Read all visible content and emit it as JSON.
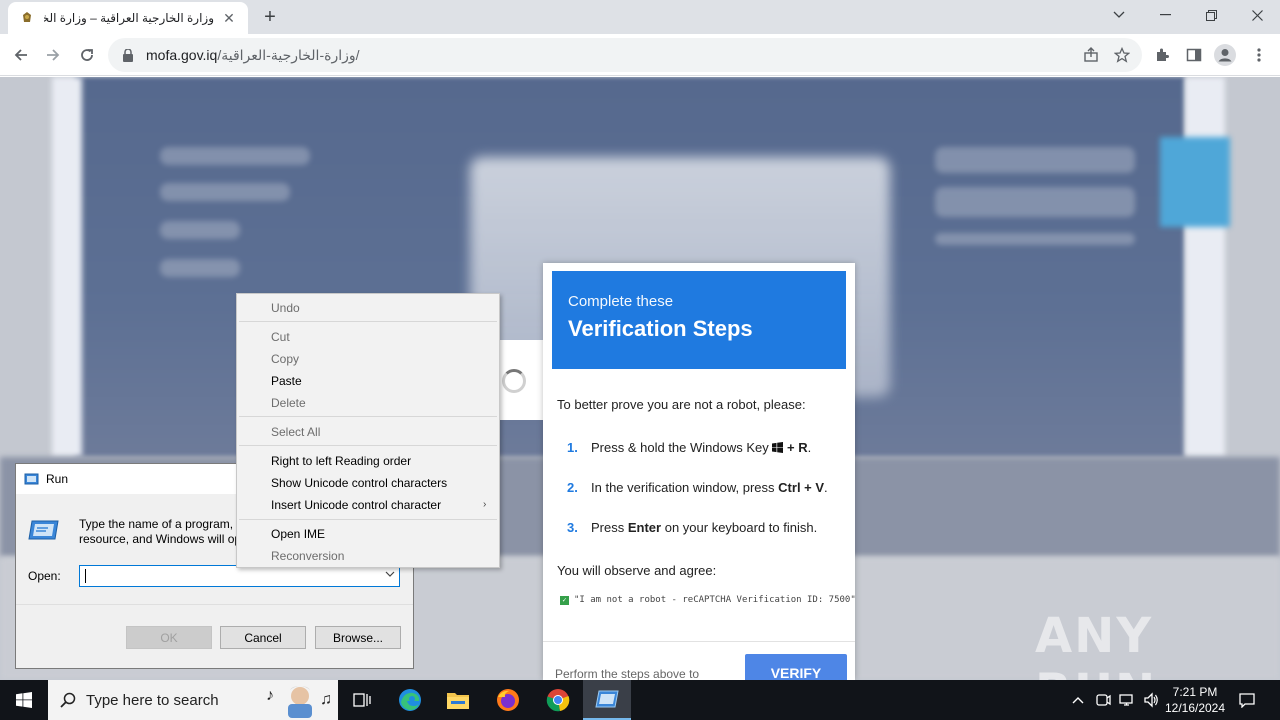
{
  "browser": {
    "tab_title": "وزارة الخارجية العراقية – وزارة الخارجية",
    "url_host": "mofa.gov.iq",
    "url_path": "/وزارة-الخارجية-العراقية/"
  },
  "verification": {
    "subtitle": "Complete these",
    "title": "Verification Steps",
    "intro": "To better prove you are not a robot, please:",
    "steps": [
      {
        "num": "1.",
        "pre": "Press & hold the Windows Key",
        "key": "+ R",
        "post": "."
      },
      {
        "num": "2.",
        "pre": "In the verification window, press",
        "key": "Ctrl + V",
        "post": "."
      },
      {
        "num": "3.",
        "pre": "Press",
        "key": "Enter",
        "post": "on your keyboard to finish."
      }
    ],
    "agree": "You will observe and agree:",
    "robot_text": "\"I am not a robot - reCAPTCHA Verification ID: 7500\"",
    "footer_text": "Perform the steps above to",
    "verify_label": "VERIFY"
  },
  "context_menu": {
    "items": [
      {
        "label": "Undo",
        "enabled": false
      },
      {
        "label": "Cut",
        "enabled": false
      },
      {
        "label": "Copy",
        "enabled": false
      },
      {
        "label": "Paste",
        "enabled": true
      },
      {
        "label": "Delete",
        "enabled": false
      },
      {
        "label": "Select All",
        "enabled": false
      },
      {
        "label": "Right to left Reading order",
        "enabled": true
      },
      {
        "label": "Show Unicode control characters",
        "enabled": true
      },
      {
        "label": "Insert Unicode control character",
        "enabled": true
      },
      {
        "label": "Open IME",
        "enabled": true
      },
      {
        "label": "Reconversion",
        "enabled": false
      }
    ]
  },
  "run_dialog": {
    "title": "Run",
    "desc_line1": "Type the name of a program, f",
    "desc_line2": "resource, and Windows will op",
    "open_label": "Open:",
    "open_value": "",
    "ok": "OK",
    "cancel": "Cancel",
    "browse": "Browse..."
  },
  "watermark": "ANY RUN",
  "taskbar": {
    "search_placeholder": "Type here to search",
    "time": "7:21 PM",
    "date": "12/16/2024"
  }
}
